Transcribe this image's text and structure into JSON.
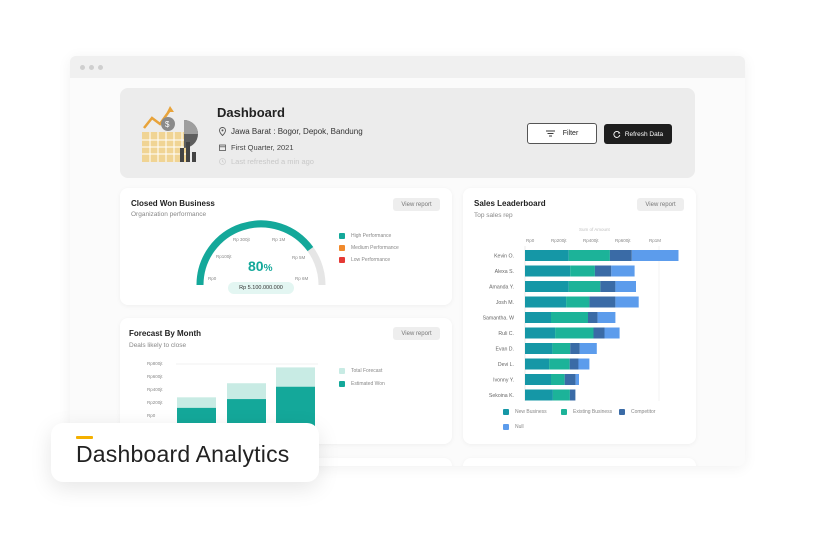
{
  "header": {
    "title": "Dashboard",
    "location": "Jawa Barat : Bogor, Depok, Bandung",
    "period": "First Quarter, 2021",
    "last_refresh": "Last refreshed a min ago",
    "filter_label": "Filter",
    "refresh_label": "Refresh Data",
    "icons": [
      "location-pin-icon",
      "calendar-icon",
      "clock-icon",
      "filter-icon",
      "refresh-icon"
    ]
  },
  "closed_won": {
    "title": "Closed Won Business",
    "subtitle": "Organization performance",
    "view_report": "View report",
    "percent": "80",
    "percent_unit": "%",
    "percent_value": 0.8,
    "amount": "Rp 5.100.000.000",
    "gauge_ticks": [
      "Rp0",
      "Rp100jt",
      "Rp 300jt",
      "Rp 1M",
      "Rp 5M",
      "Rp 6M"
    ],
    "legend": [
      {
        "label": "High Performance",
        "color": "#14a89a"
      },
      {
        "label": "Medium Performance",
        "color": "#f08a2c"
      },
      {
        "label": "Low Performance",
        "color": "#e53935"
      }
    ]
  },
  "forecast": {
    "title": "Forecast By Month",
    "subtitle": "Deals likely to close",
    "view_report": "View report",
    "legend": [
      {
        "label": "Total Forecast",
        "color": "#c8ebe4"
      },
      {
        "label": "Estimated Won",
        "color": "#14a89a"
      }
    ]
  },
  "leaderboard": {
    "title": "Sales Leaderboard",
    "subtitle": "Top sales rep",
    "view_report": "View report",
    "axis_title": "Sum of Amount",
    "legend": [
      {
        "label": "New Business",
        "color": "#1597a6"
      },
      {
        "label": "Existing Business",
        "color": "#1cb399"
      },
      {
        "label": "Competitor",
        "color": "#3a6ba6"
      },
      {
        "label": "Null",
        "color": "#5c9cec"
      }
    ]
  },
  "overlay": {
    "label": "Dashboard Analytics",
    "accent_color": "#f4b000"
  },
  "chart_data": [
    {
      "type": "bar",
      "orientation": "vertical",
      "title": "Forecast By Month",
      "y_ticks": [
        "Rp800jt",
        "Rp600jt",
        "Rp400jt",
        "Rp200jt",
        "Rp0"
      ],
      "ylim": [
        0,
        800
      ],
      "series": [
        {
          "name": "Total Forecast",
          "values": [
            180,
            260,
            350
          ]
        },
        {
          "name": "Estimated Won",
          "values": [
            120,
            170,
            240
          ]
        }
      ]
    },
    {
      "type": "bar",
      "orientation": "horizontal",
      "stacked": true,
      "title": "Sales Leaderboard",
      "xlabel": "Sum of Amount",
      "x_ticks": [
        "Rp0",
        "Rp200jt",
        "Rp400jt",
        "Rp600jt",
        "Rp1M"
      ],
      "categories": [
        "Kevin O.",
        "Alexa S.",
        "Amanda Y.",
        "Josh M.",
        "Samantha. W",
        "Ruli C.",
        "Evan D.",
        "Devi L.",
        "Ivonny Y.",
        "Sekoina K."
      ],
      "series": [
        {
          "name": "New Business",
          "values": [
            160,
            165,
            160,
            150,
            95,
            110,
            100,
            88,
            95,
            102
          ]
        },
        {
          "name": "Existing Business",
          "values": [
            150,
            90,
            115,
            85,
            135,
            140,
            65,
            75,
            50,
            62
          ]
        },
        {
          "name": "Competitor",
          "values": [
            80,
            60,
            55,
            95,
            35,
            40,
            35,
            32,
            40,
            20
          ]
        },
        {
          "name": "Null",
          "values": [
            170,
            85,
            75,
            85,
            65,
            55,
            62,
            40,
            12,
            0
          ]
        }
      ]
    }
  ]
}
